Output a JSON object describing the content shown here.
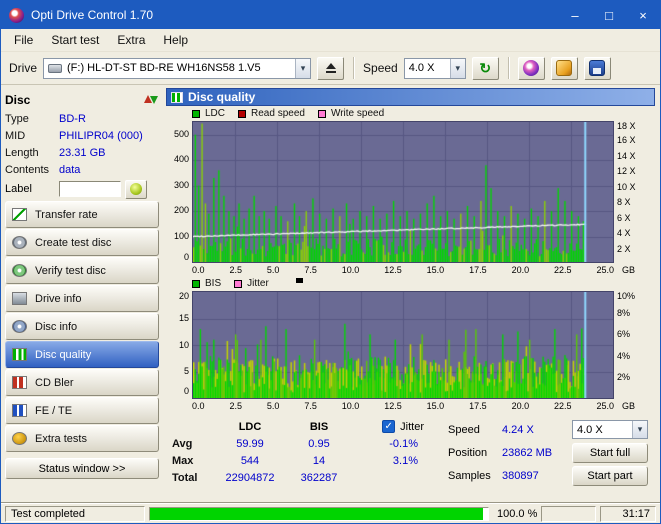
{
  "window": {
    "title": "Opti Drive Control 1.70",
    "minimize": "–",
    "maximize": "□",
    "close": "×"
  },
  "icons": {
    "dropdown": "▾",
    "refresh": "↻",
    "check": "✓"
  },
  "menu": {
    "items": [
      "File",
      "Start test",
      "Extra",
      "Help"
    ]
  },
  "toolbar": {
    "drive_label": "Drive",
    "drive_value": "(F:)  HL-DT-ST BD-RE  WH16NS58 1.V5",
    "speed_label": "Speed",
    "speed_value": "4.0 X"
  },
  "sidebar": {
    "header": "Disc",
    "info": [
      {
        "label": "Type",
        "value": "BD-R"
      },
      {
        "label": "MID",
        "value": "PHILIPR04 (000)"
      },
      {
        "label": "Length",
        "value": "23.31 GB"
      },
      {
        "label": "Contents",
        "value": "data"
      }
    ],
    "label_field": {
      "label": "Label",
      "value": ""
    },
    "buttons": [
      {
        "label": "Transfer rate"
      },
      {
        "label": "Create test disc"
      },
      {
        "label": "Verify test disc"
      },
      {
        "label": "Drive info"
      },
      {
        "label": "Disc info"
      },
      {
        "label": "Disc quality",
        "active": true
      },
      {
        "label": "CD Bler"
      },
      {
        "label": "FE / TE"
      },
      {
        "label": "Extra tests"
      }
    ],
    "status_window": "Status window >>"
  },
  "panel": {
    "title": "Disc quality"
  },
  "stats": {
    "headers": {
      "ldc": "LDC",
      "bis": "BIS"
    },
    "jitter_label": "Jitter",
    "rows": [
      {
        "label": "Avg",
        "ldc": "59.99",
        "bis": "0.95",
        "jit": "-0.1%"
      },
      {
        "label": "Max",
        "ldc": "544",
        "bis": "14",
        "jit": "3.1%"
      },
      {
        "label": "Total",
        "ldc": "22904872",
        "bis": "362287",
        "jit": ""
      }
    ]
  },
  "controls_right": {
    "speed_label": "Speed",
    "speed_value": "4.24 X",
    "speed_option": "4.0 X",
    "position_label": "Position",
    "position_value": "23862 MB",
    "start_full": "Start full",
    "samples_label": "Samples",
    "samples_value": "380897",
    "start_part": "Start part"
  },
  "statusbar": {
    "status": "Test completed",
    "percent": "100.0 %",
    "time": "31:17",
    "progress_width": "98.5%",
    "progress_color": "#00d400"
  },
  "chart_data": [
    {
      "type": "bar",
      "name": "LDC errors with read/write speed overlay",
      "legend": [
        {
          "label": "LDC",
          "color": "#00b400"
        },
        {
          "label": "Read speed",
          "color": "#b40000"
        },
        {
          "label": "Write speed",
          "color": "#ff7ad2"
        }
      ],
      "yl": [
        "500",
        "400",
        "300",
        "200",
        "100",
        "0"
      ],
      "yr": [
        "18 X",
        "16 X",
        "14 X",
        "12 X",
        "10 X",
        "8 X",
        "6 X",
        "4 X",
        "2 X"
      ],
      "xt": [
        "0.0",
        "2.5",
        "5.0",
        "7.5",
        "10.0",
        "12.5",
        "15.0",
        "17.5",
        "20.0",
        "22.5",
        "25.0"
      ],
      "xu": "GB",
      "left_max": 550,
      "x_max": 25,
      "data_end": 23.35,
      "grid_vals": [
        100,
        200,
        300,
        400,
        500
      ],
      "seed": 11,
      "base": [
        22,
        92
      ],
      "boost_p": 0.1,
      "boost": 1.9,
      "bar_colors": [
        "#00d800",
        "#8cd400"
      ],
      "spikes": [
        [
          0.1,
          500
        ],
        [
          0.25,
          300
        ],
        [
          0.5,
          544
        ],
        [
          0.7,
          230
        ],
        [
          0.9,
          190
        ],
        [
          1.2,
          330
        ],
        [
          1.5,
          360
        ],
        [
          1.8,
          260
        ],
        [
          2.1,
          200
        ],
        [
          2.4,
          180
        ],
        [
          2.7,
          230
        ],
        [
          3.0,
          170
        ],
        [
          3.3,
          210
        ],
        [
          3.6,
          260
        ],
        [
          3.9,
          180
        ],
        [
          4.2,
          200
        ],
        [
          4.5,
          170
        ],
        [
          4.9,
          220
        ],
        [
          5.2,
          180
        ],
        [
          5.6,
          160
        ],
        [
          6.0,
          230
        ],
        [
          6.3,
          180
        ],
        [
          6.7,
          200
        ],
        [
          7.1,
          250
        ],
        [
          7.5,
          190
        ],
        [
          7.9,
          170
        ],
        [
          8.3,
          210
        ],
        [
          8.7,
          180
        ],
        [
          9.1,
          230
        ],
        [
          9.5,
          170
        ],
        [
          9.9,
          200
        ],
        [
          10.3,
          180
        ],
        [
          10.7,
          220
        ],
        [
          11.1,
          170
        ],
        [
          11.5,
          190
        ],
        [
          11.9,
          240
        ],
        [
          12.3,
          180
        ],
        [
          12.7,
          200
        ],
        [
          13.1,
          170
        ],
        [
          13.5,
          190
        ],
        [
          13.9,
          230
        ],
        [
          14.3,
          260
        ],
        [
          14.7,
          180
        ],
        [
          15.1,
          200
        ],
        [
          15.5,
          170
        ],
        [
          15.9,
          190
        ],
        [
          16.3,
          220
        ],
        [
          16.7,
          180
        ],
        [
          17.1,
          240
        ],
        [
          17.4,
          380
        ],
        [
          17.7,
          290
        ],
        [
          18.1,
          200
        ],
        [
          18.5,
          180
        ],
        [
          18.9,
          220
        ],
        [
          19.3,
          190
        ],
        [
          19.7,
          170
        ],
        [
          20.1,
          210
        ],
        [
          20.5,
          180
        ],
        [
          20.9,
          240
        ],
        [
          21.3,
          200
        ],
        [
          21.7,
          290
        ],
        [
          22.1,
          240
        ],
        [
          22.5,
          200
        ],
        [
          22.9,
          180
        ],
        [
          23.2,
          160
        ]
      ],
      "line": {
        "from": 100,
        "to": 148,
        "color": "#f5f5f5"
      },
      "cursor": 23.35,
      "cursor_color": "#8fd8ff",
      "avg": 59.99,
      "max": 544,
      "total": 22904872,
      "speed_avg_x": 4.24
    },
    {
      "type": "bar",
      "name": "BIS errors with jitter overlay",
      "legend": [
        {
          "label": "BIS",
          "color": "#00b400"
        },
        {
          "label": "Jitter",
          "color": "#ff7ad2"
        }
      ],
      "yl": [
        "20",
        "15",
        "10",
        "5",
        "0"
      ],
      "yr": [
        "10%",
        "8%",
        "6%",
        "4%",
        "2%"
      ],
      "xt": [
        "0.0",
        "2.5",
        "5.0",
        "7.5",
        "10.0",
        "12.5",
        "15.0",
        "17.5",
        "20.0",
        "22.5",
        "25.0"
      ],
      "xu": "GB",
      "left_max": 20,
      "x_max": 25,
      "data_end": 23.35,
      "grid_vals": [
        5,
        10,
        15
      ],
      "seed": 23,
      "base": [
        1,
        8
      ],
      "boost_p": 0.12,
      "boost": 1.7,
      "bar_colors": [
        "#00d800",
        "#58cc00"
      ],
      "jitter_band": [
        2,
        7.5
      ],
      "jitter_color": "#c2d400",
      "spikes": [
        [
          0.4,
          13
        ],
        [
          1.2,
          11
        ],
        [
          2.5,
          12
        ],
        [
          4.0,
          11
        ],
        [
          5.5,
          13
        ],
        [
          7.2,
          11
        ],
        [
          9.0,
          14
        ],
        [
          10.5,
          12
        ],
        [
          12.0,
          11
        ],
        [
          13.6,
          12
        ],
        [
          15.2,
          11
        ],
        [
          16.8,
          13
        ],
        [
          18.4,
          12
        ],
        [
          20.0,
          11
        ],
        [
          21.5,
          13
        ],
        [
          22.8,
          12
        ]
      ],
      "cursor": 23.35,
      "cursor_color": "#8fd8ff",
      "avg": 0.95,
      "max": 14,
      "total": 362287,
      "jitter_avg_pct": -0.1,
      "jitter_max_pct": 3.1
    }
  ]
}
